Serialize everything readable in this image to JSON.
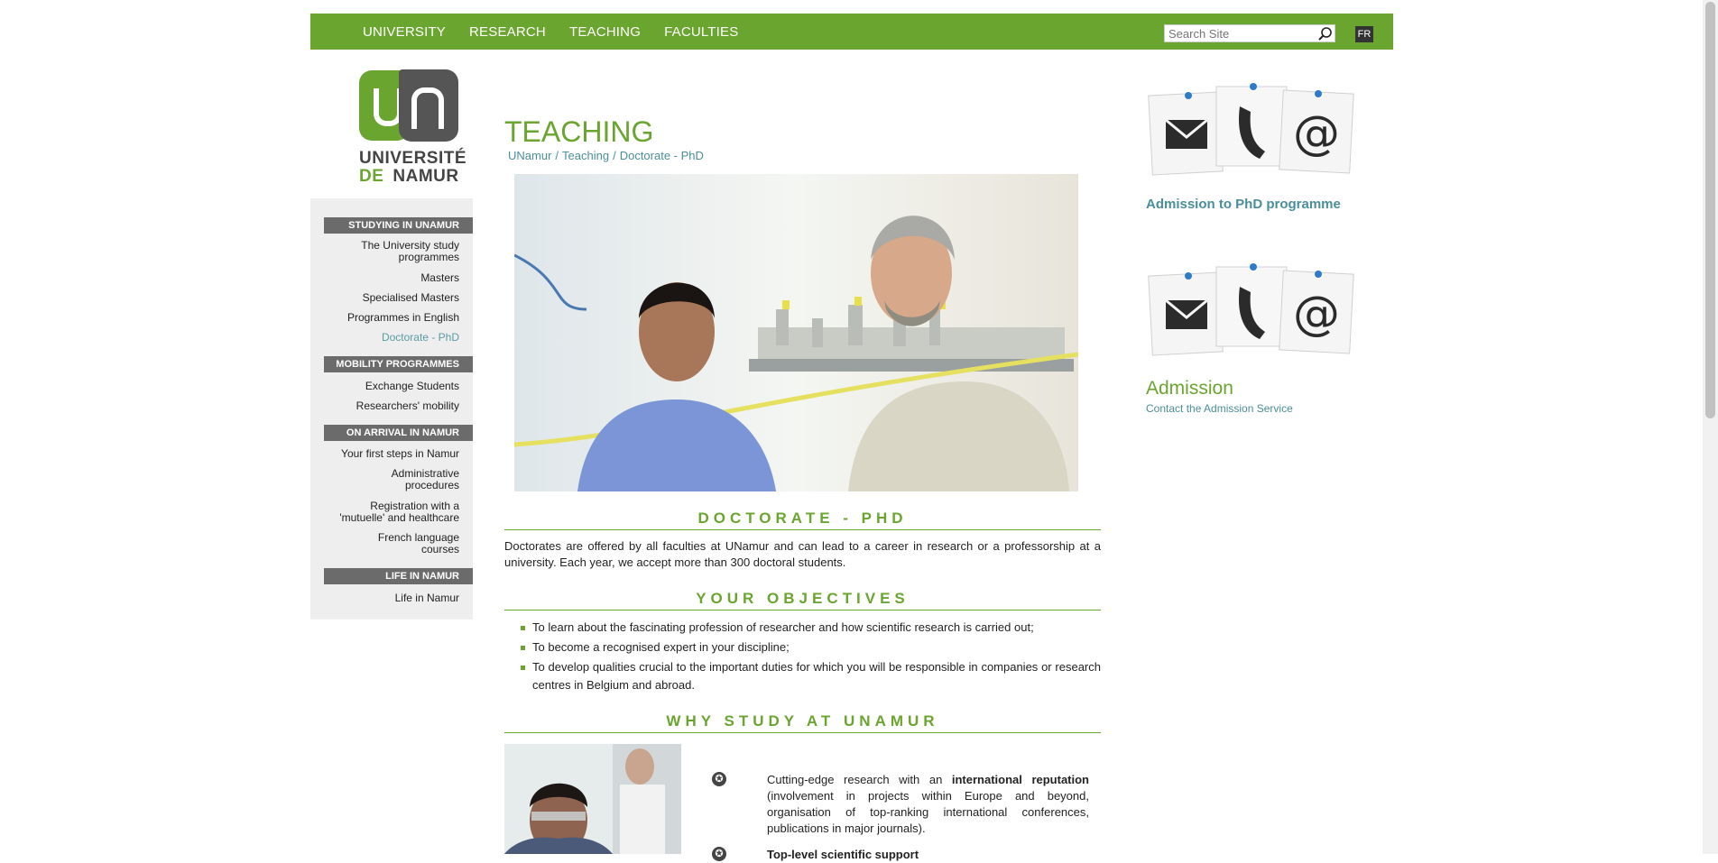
{
  "nav": {
    "items": [
      "UNIVERSITY",
      "RESEARCH",
      "TEACHING",
      "FACULTIES"
    ],
    "search_placeholder": "Search Site",
    "lang": "FR"
  },
  "logo": {
    "line1": "UNIVERSITÉ",
    "de": "DE",
    "namur": "NAMUR"
  },
  "sidebar": {
    "sections": [
      {
        "heading": "STUDYING IN UNAMUR",
        "items": [
          "The University study programmes",
          "Masters",
          "Specialised Masters",
          "Programmes in English",
          "Doctorate - PhD"
        ]
      },
      {
        "heading": "MOBILITY PROGRAMMES",
        "items": [
          "Exchange Students",
          "Researchers' mobility"
        ]
      },
      {
        "heading": "ON ARRIVAL IN NAMUR",
        "items": [
          "Your first steps in Namur",
          "Administrative procedures",
          "Registration with a 'mutuelle' and healthcare",
          "French language courses"
        ]
      },
      {
        "heading": "LIFE IN NAMUR",
        "items": [
          "Life in Namur"
        ]
      }
    ],
    "active_item": "Doctorate - PhD"
  },
  "main": {
    "title": "TEACHING",
    "breadcrumb": [
      "UNamur",
      "Teaching",
      "Doctorate - PhD"
    ],
    "breadcrumb_sep": "/",
    "sec1_title": "DOCTORATE - PHD",
    "sec1_text": "Doctorates are offered by all faculties at UNamur and can lead to a career in research or a professorship at a university. Each year, we accept more than 300 doctoral students.",
    "sec2_title": "YOUR OBJECTIVES",
    "objectives": [
      "To learn about the fascinating profession of researcher and how scientific research is carried out;",
      "To become a recognised expert in your discipline;",
      "To develop qualities crucial to the important duties for which you will be responsible in companies or research centres in Belgium and abroad."
    ],
    "sec3_title": "WHY STUDY AT UNAMUR",
    "why": [
      {
        "pre": "Cutting-edge research with an ",
        "bold": "international reputation",
        "post": " (involvement in projects within Europe and beyond, organisation of top-ranking international conferences, publications in major journals)."
      },
      {
        "pre": "",
        "bold": "Top-level scientific support",
        "post": ""
      }
    ]
  },
  "right": {
    "admission_phd_link": "Admission to PhD programme",
    "admission_title": "Admission",
    "admission_sub": "Contact the Admission Service"
  },
  "colors": {
    "brand_green": "#6aa52f",
    "link_teal": "#4a8f99",
    "sidebar_head": "#6b6b6b"
  }
}
